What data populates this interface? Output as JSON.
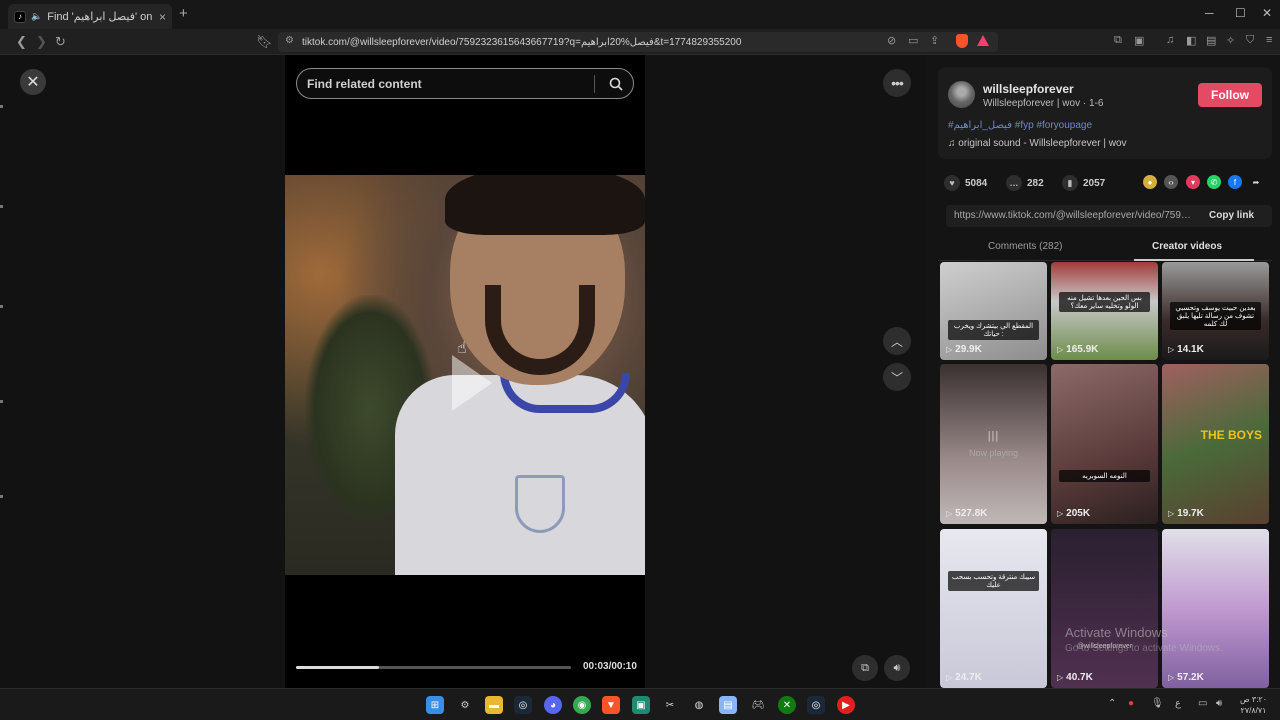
{
  "browser": {
    "tab_title": "Find 'فيصل ابراهيم' on TikTok",
    "tab_close": "×",
    "new_tab": "+",
    "url": "tiktok.com/@willsleepforever/video/7592323615643667719?q=فيصل%20ابراهيم&t=1774829355200",
    "window_controls": [
      "─",
      "☐",
      "✕"
    ]
  },
  "page": {
    "close_label": "✕",
    "search_placeholder": "Find related content",
    "time": "00:03/00:10",
    "progress_fraction": 0.3,
    "more_label": "•••"
  },
  "creator": {
    "username": "willsleepforever",
    "subtitle": "Willsleepforever | wov · 1-6",
    "follow_label": "Follow",
    "tags": "#فيصل_ابراهيم #fyp #foryoupage",
    "sound": "♫  original sound - Willsleepforever | wov"
  },
  "stats": {
    "likes": "5084",
    "comments": "282",
    "saves": "2057"
  },
  "share_colors": [
    "#d4b03a",
    "#555555",
    "#e03a5c",
    "#25d366",
    "#1877f2",
    "#ffffff"
  ],
  "link": {
    "url": "https://www.tiktok.com/@willsleepforever/video/75923...",
    "copy_label": "Copy link"
  },
  "tabs": {
    "comments": "Comments (282)",
    "creator_videos": "Creator videos"
  },
  "videos": [
    {
      "views": "29.9K",
      "caption": "المقطع الي بيتشرك ويخرب حياتك :",
      "bg": "linear-gradient(160deg,#cfcfcf,#8d8d8d)"
    },
    {
      "views": "165.9K",
      "caption": "بس الحين بعدها تشيل منه الولو وتخليه ساير معك؟",
      "bg": "linear-gradient(180deg,#a33a3a 0%,#c8c8c8 40%,#6d8d4a 100%)"
    },
    {
      "views": "14.1K",
      "caption": "بعدين حبيت يوسف وتحسبي تشوف من رسالة تليها يلبق لك كلمه",
      "bg": "linear-gradient(180deg,#9a9a9a 0%,#3a2a2a 60%,#1a1a1a 100%)"
    },
    {
      "views": "527.8K",
      "now_playing": "Now playing",
      "bg": "linear-gradient(180deg,#3a3030,#9a8a8a 60%,#c0b8b8)"
    },
    {
      "views": "205K",
      "caption": "النومه السوبريه",
      "bg": "linear-gradient(160deg,#8d6a6a,#5a3a3a 60%,#2a2020)"
    },
    {
      "views": "19.7K",
      "caption": "THE BOYS",
      "bg": "linear-gradient(160deg,#a06060,#4a6a3a 50%,#5a4030)"
    },
    {
      "views": "24.7K",
      "caption": "سيبك منترقة وتحسب بسحب عليك",
      "bg": "linear-gradient(180deg,#e8e8f0,#c8c8d8)"
    },
    {
      "views": "40.7K",
      "caption": "@willsleepforever",
      "bg": "linear-gradient(180deg,#2a2030,#503050)"
    },
    {
      "views": "57.2K",
      "caption": "",
      "bg": "linear-gradient(180deg,#e0e0e8 0%,#c09ad0 50%,#8060a0 100%)"
    }
  ],
  "watermark": {
    "line1": "Activate Windows",
    "line2": "Go to Settings to activate Windows."
  },
  "taskbar": {
    "clock_time": "٣:٢٠ ص",
    "clock_date": "٢٧/٨/٧١",
    "lang": "ع"
  }
}
